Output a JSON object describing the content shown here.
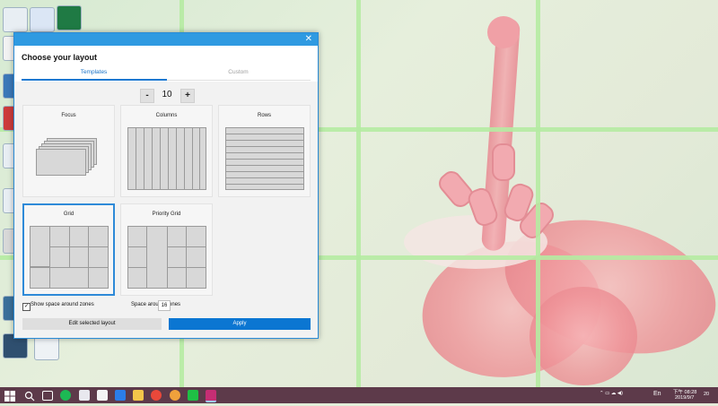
{
  "dialog": {
    "title": "Choose your layout",
    "close_glyph": "✕",
    "tabs": [
      {
        "label": "Templates",
        "active": true
      },
      {
        "label": "Custom",
        "active": false
      }
    ],
    "zone_count": {
      "minus": "-",
      "value": "10",
      "plus": "+"
    },
    "layouts": [
      {
        "name": "Focus",
        "selected": false
      },
      {
        "name": "Columns",
        "selected": false
      },
      {
        "name": "Rows",
        "selected": false
      },
      {
        "name": "Grid",
        "selected": true
      },
      {
        "name": "Priority Grid",
        "selected": false
      }
    ],
    "show_space_label": "Show space around zones",
    "show_space_checked": true,
    "check_glyph": "✓",
    "space_around_label": "Space around zones",
    "space_around_value": "16",
    "edit_button": "Edit selected layout",
    "apply_button": "Apply"
  },
  "taskbar": {
    "time": "下午 08:28",
    "date": "2019/9/7",
    "ime_label": "En",
    "notification_count": "20"
  },
  "colors": {
    "accent": "#0b76d2",
    "title_bar": "#2f9ae1",
    "taskbar": "#5d3a4a",
    "zone_lines": "#b5eba2"
  }
}
